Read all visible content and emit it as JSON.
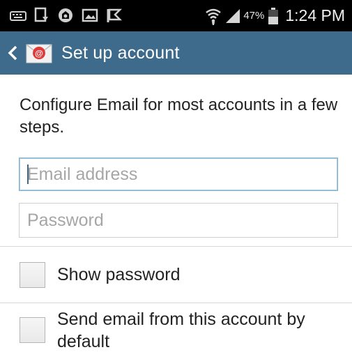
{
  "status_bar": {
    "battery_percent": "47%",
    "time": "1:24 PM",
    "icons": [
      "keyboard-icon",
      "download-icon",
      "app-notification-icon",
      "gallery-icon",
      "flag-icon",
      "wifi-icon",
      "signal-icon",
      "battery-icon"
    ]
  },
  "action_bar": {
    "title": "Set up account",
    "back_icon": "chevron-left-icon",
    "app_icon": "email-app-icon",
    "color": "#3e6b8c"
  },
  "intro": {
    "text": "Configure Email for most accounts in a few steps."
  },
  "form": {
    "email_placeholder": "Email address",
    "email_value": "",
    "password_placeholder": "Password",
    "password_value": ""
  },
  "options": {
    "show_password_label": "Show password",
    "show_password_checked": false,
    "default_account_label": "Send email from this account by default",
    "default_account_checked": false
  }
}
